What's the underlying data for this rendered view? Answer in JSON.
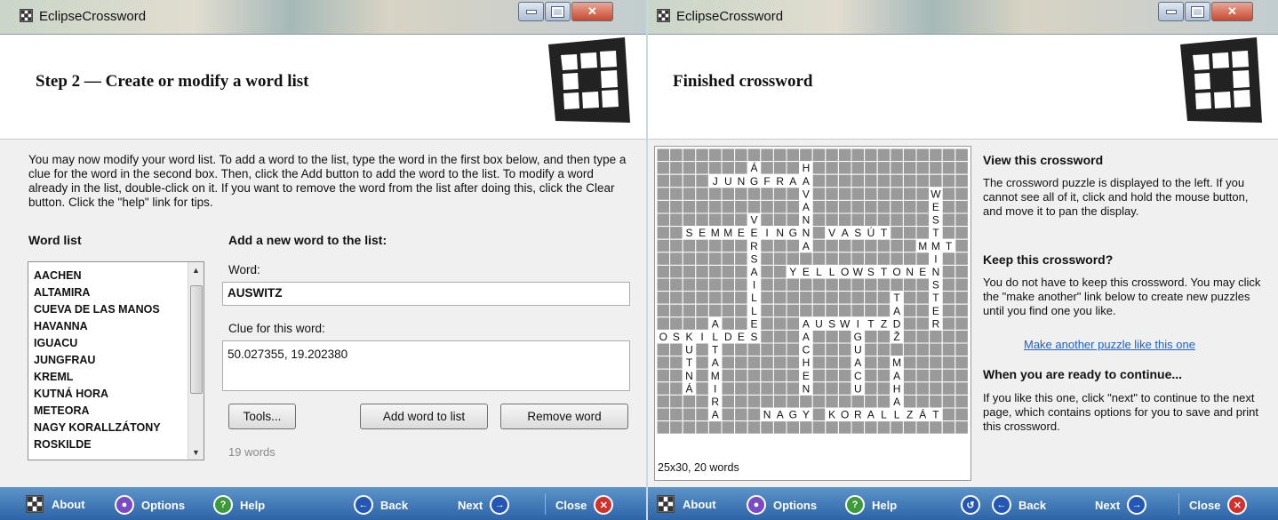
{
  "colors": {
    "accent": "#2c64a7",
    "link": "#2060c8",
    "close_button": "#c74a30"
  },
  "left": {
    "title": "EclipseCrossword",
    "header_title": "Step 2 — Create or modify a word list",
    "intro": "You may now modify your word list.  To add a word to the list, type the word in the first box below, and then type a clue for the word in the second box.  Then, click the Add button to add the word to the list.  To modify a word already in the list, double-click on it.  If you want to remove the word from the list after doing this, click the Clear button.  Click the \"help\" link for tips.",
    "word_list_heading": "Word list",
    "word_list": [
      "AACHEN",
      "ALTAMIRA",
      "CUEVA DE LAS MANOS",
      "HAVANNA",
      "IGUACU",
      "JUNGFRAU",
      "KREML",
      "KUTNÁ HORA",
      "METEORA",
      "NAGY KORALLZÁTONY",
      "ROSKILDE"
    ],
    "add_heading": "Add a new word to the list:",
    "word_label": "Word:",
    "word_value": "AUSWITZ",
    "clue_label": "Clue for this word:",
    "clue_value": "50.027355, 19.202380",
    "tools_button": "Tools...",
    "add_button": "Add word to list",
    "remove_button": "Remove word",
    "word_count": "19 words",
    "footer": {
      "about": "About",
      "options": "Options",
      "help": "Help",
      "back": "Back",
      "next": "Next",
      "close": "Close"
    }
  },
  "right": {
    "title": "EclipseCrossword",
    "header_title": "Finished crossword",
    "size_info": "25x30, 20 words",
    "view_heading": "View this crossword",
    "view_text": "The crossword puzzle is displayed to the left.  If you cannot see all of it, click and hold the mouse button, and move it to pan the display.",
    "keep_heading": "Keep this crossword?",
    "keep_text": "You do not have to keep this crossword.  You may click the \"make another\" link below to create new puzzles until you find one you like.",
    "make_another_link": "Make another puzzle like this one",
    "ready_heading": "When you are ready to continue...",
    "ready_text": "If you like this one, click \"next\" to continue to the next page, which contains options for you to save and print this crossword.",
    "footer": {
      "about": "About",
      "options": "Options",
      "help": "Help",
      "back": "Back",
      "next": "Next",
      "close": "Close"
    }
  },
  "crossword": {
    "cols": 24,
    "rows": 22,
    "words": [
      {
        "text": "JUNGFRAU",
        "row": 2,
        "col": 4,
        "dir": "across"
      },
      {
        "text": "SEMMERINGI VASÚT",
        "row": 6,
        "col": 2,
        "dir": "across"
      },
      {
        "text": "YELLOWSTONE",
        "row": 9,
        "col": 10,
        "dir": "across"
      },
      {
        "text": "AUSWITZ",
        "row": 13,
        "col": 11,
        "dir": "across"
      },
      {
        "text": "OSKILDE",
        "row": 14,
        "col": 0,
        "dir": "across"
      },
      {
        "text": "NAGY KORALLZÁT",
        "row": 20,
        "col": 8,
        "dir": "across"
      },
      {
        "text": "MET",
        "row": 7,
        "col": 20,
        "dir": "across"
      },
      {
        "text": "HAVANNA",
        "row": 1,
        "col": 11,
        "dir": "down"
      },
      {
        "text": "WESTMINSTER",
        "row": 3,
        "col": 21,
        "dir": "down"
      },
      {
        "text": "VERSAILLES",
        "row": 5,
        "col": 7,
        "dir": "down"
      },
      {
        "text": "AACHEN",
        "row": 13,
        "col": 11,
        "dir": "down"
      },
      {
        "text": "ALTAMIRA",
        "row": 13,
        "col": 4,
        "dir": "down"
      },
      {
        "text": "KUTNÁ",
        "row": 14,
        "col": 2,
        "dir": "down"
      },
      {
        "text": "IGUACU",
        "row": 13,
        "col": 15,
        "dir": "down"
      },
      {
        "text": "TADŽ",
        "row": 11,
        "col": 18,
        "dir": "down"
      },
      {
        "text": "MAHA",
        "row": 16,
        "col": 18,
        "dir": "down"
      },
      {
        "text": "Á",
        "row": 1,
        "col": 7,
        "dir": "down"
      }
    ]
  }
}
